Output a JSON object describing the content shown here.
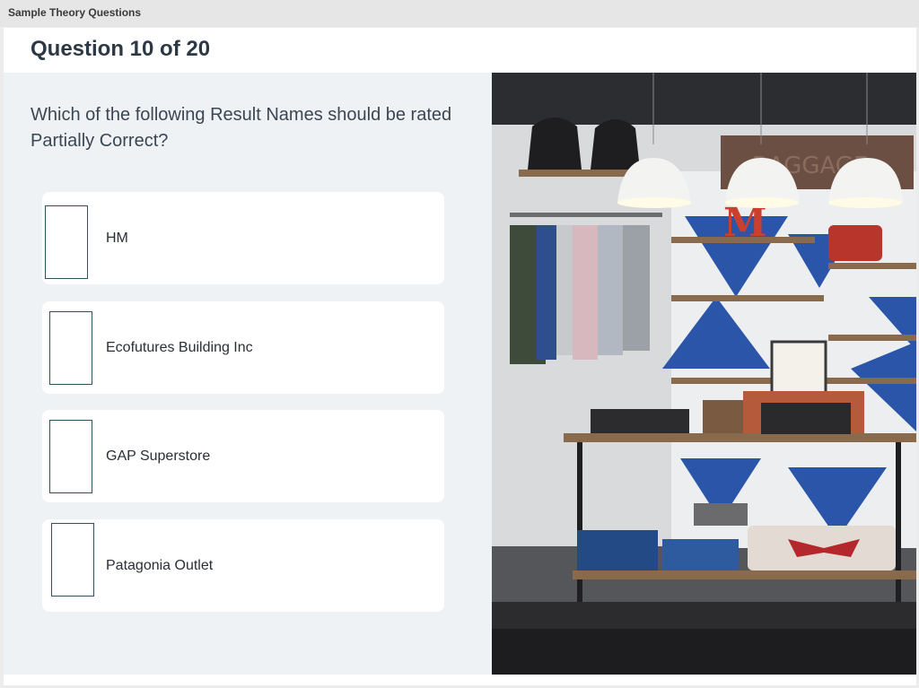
{
  "app": {
    "title": "Sample Theory Questions"
  },
  "question": {
    "header": "Question 10 of 20",
    "prompt": "Which of the following Result Names should be rated Partially Correct?",
    "options": [
      {
        "label": "HM"
      },
      {
        "label": "Ecofutures Building Inc"
      },
      {
        "label": "GAP Superstore"
      },
      {
        "label": "Patagonia Outlet"
      }
    ]
  },
  "photo": {
    "subject": "clothing store interior",
    "sign_text": "BAGGAGE",
    "letter_text": "M"
  },
  "colors": {
    "pane_background": "#eff2f5",
    "checkbox_border": "#2f5260",
    "header_text": "#2c3845"
  }
}
